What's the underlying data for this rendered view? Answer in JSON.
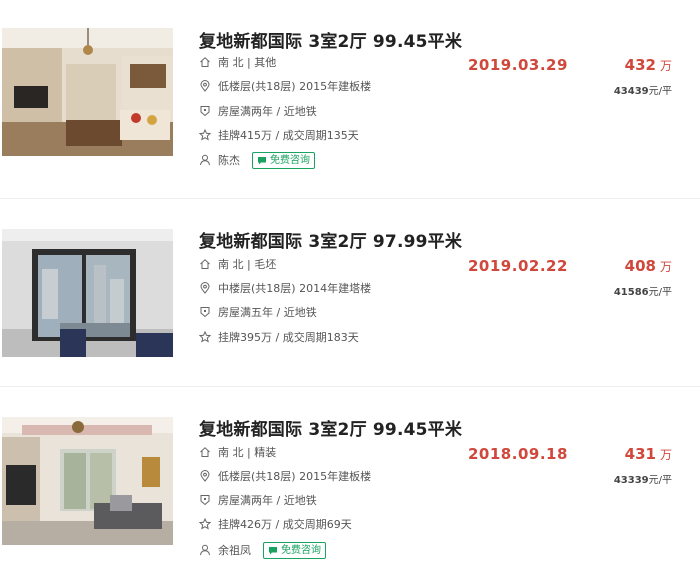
{
  "listings": [
    {
      "title": "复地新都国际 3室2厅 99.45平米",
      "orientation_decoration": "南 北 | 其他",
      "floor_info": "低楼层(共18层) 2015年建板楼",
      "tags": "房屋满两年 / 近地铁",
      "listing_info": "挂牌415万 / 成交周期135天",
      "agent_name": "陈杰",
      "consult_label": "免费咨询",
      "deal_date": "2019.03.29",
      "total_price": "432",
      "price_unit": "万",
      "unit_price": "43439",
      "unit_price_suffix": "元/平"
    },
    {
      "title": "复地新都国际 3室2厅 97.99平米",
      "orientation_decoration": "南 北 | 毛坯",
      "floor_info": "中楼层(共18层) 2014年建塔楼",
      "tags": "房屋满五年 / 近地铁",
      "listing_info": "挂牌395万 / 成交周期183天",
      "deal_date": "2019.02.22",
      "total_price": "408",
      "price_unit": "万",
      "unit_price": "41586",
      "unit_price_suffix": "元/平"
    },
    {
      "title": "复地新都国际 3室2厅 99.45平米",
      "orientation_decoration": "南 北 | 精装",
      "floor_info": "低楼层(共18层) 2015年建板楼",
      "tags": "房屋满两年 / 近地铁",
      "listing_info": "挂牌426万 / 成交周期69天",
      "agent_name": "余祖凤",
      "consult_label": "免费咨询",
      "deal_date": "2018.09.18",
      "total_price": "431",
      "price_unit": "万",
      "unit_price": "43339",
      "unit_price_suffix": "元/平"
    }
  ],
  "colors": {
    "accent_red": "#d0473b",
    "consult_green": "#1aa260"
  },
  "icons": [
    "house-icon",
    "location-pin-icon",
    "shield-icon",
    "star-icon",
    "person-icon",
    "chat-bubble-icon"
  ]
}
